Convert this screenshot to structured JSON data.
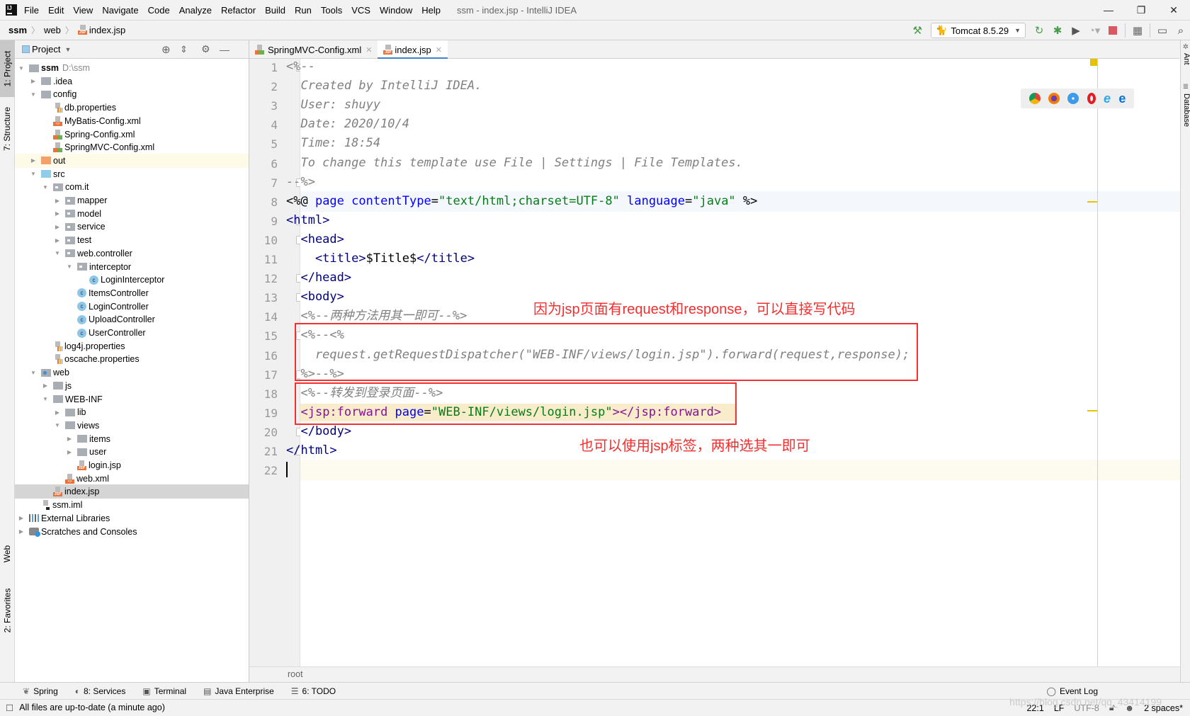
{
  "window": {
    "title": "ssm - index.jsp - IntelliJ IDEA",
    "menu": [
      "File",
      "Edit",
      "View",
      "Navigate",
      "Code",
      "Analyze",
      "Refactor",
      "Build",
      "Run",
      "Tools",
      "VCS",
      "Window",
      "Help"
    ],
    "controls": {
      "minimize": "—",
      "maximize": "❐",
      "close": "✕"
    }
  },
  "breadcrumb": [
    "ssm",
    "web",
    "index.jsp"
  ],
  "toolbar": {
    "run_config": "Tomcat 8.5.29",
    "icons": [
      "build-hammer-icon",
      "rerun-icon",
      "debug-icon",
      "coverage-icon",
      "profile-icon",
      "stop-icon",
      "project-structure-icon",
      "run-anything-icon",
      "search-everywhere-icon"
    ]
  },
  "left_stripe": {
    "project": "1: Project",
    "structure": "7: Structure",
    "web": "Web",
    "favorites": "2: Favorites"
  },
  "right_stripe": {
    "ant": "Ant",
    "database": "Database"
  },
  "project_panel": {
    "title": "Project",
    "tree": [
      {
        "label": "ssm",
        "hint": "D:\\ssm",
        "depth": 0,
        "arrow": "down",
        "icon": "folder",
        "bold": true
      },
      {
        "label": ".idea",
        "depth": 1,
        "arrow": "right",
        "icon": "folder"
      },
      {
        "label": "config",
        "depth": 1,
        "arrow": "down",
        "icon": "folder"
      },
      {
        "label": "db.properties",
        "depth": 2,
        "icon": "props"
      },
      {
        "label": "MyBatis-Config.xml",
        "depth": 2,
        "icon": "xml"
      },
      {
        "label": "Spring-Config.xml",
        "depth": 2,
        "icon": "spring"
      },
      {
        "label": "SpringMVC-Config.xml",
        "depth": 2,
        "icon": "spring"
      },
      {
        "label": "out",
        "depth": 1,
        "arrow": "right",
        "icon": "folder-orange",
        "highlight": true
      },
      {
        "label": "src",
        "depth": 1,
        "arrow": "down",
        "icon": "folder-blue"
      },
      {
        "label": "com.it",
        "depth": 2,
        "arrow": "down",
        "icon": "pkg"
      },
      {
        "label": "mapper",
        "depth": 3,
        "arrow": "right",
        "icon": "pkg"
      },
      {
        "label": "model",
        "depth": 3,
        "arrow": "right",
        "icon": "pkg"
      },
      {
        "label": "service",
        "depth": 3,
        "arrow": "right",
        "icon": "pkg"
      },
      {
        "label": "test",
        "depth": 3,
        "arrow": "right",
        "icon": "pkg"
      },
      {
        "label": "web.controller",
        "depth": 3,
        "arrow": "down",
        "icon": "pkg"
      },
      {
        "label": "interceptor",
        "depth": 4,
        "arrow": "down",
        "icon": "pkg"
      },
      {
        "label": "LoginInterceptor",
        "depth": 5,
        "icon": "class"
      },
      {
        "label": "ItemsController",
        "depth": 4,
        "icon": "class"
      },
      {
        "label": "LoginController",
        "depth": 4,
        "icon": "class"
      },
      {
        "label": "UploadController",
        "depth": 4,
        "icon": "class"
      },
      {
        "label": "UserController",
        "depth": 4,
        "icon": "class"
      },
      {
        "label": "log4j.properties",
        "depth": 2,
        "icon": "props"
      },
      {
        "label": "oscache.properties",
        "depth": 2,
        "icon": "props"
      },
      {
        "label": "web",
        "depth": 1,
        "arrow": "down",
        "icon": "web"
      },
      {
        "label": "js",
        "depth": 2,
        "arrow": "right",
        "icon": "folder"
      },
      {
        "label": "WEB-INF",
        "depth": 2,
        "arrow": "down",
        "icon": "folder"
      },
      {
        "label": "lib",
        "depth": 3,
        "arrow": "right",
        "icon": "folder"
      },
      {
        "label": "views",
        "depth": 3,
        "arrow": "down",
        "icon": "folder"
      },
      {
        "label": "items",
        "depth": 4,
        "arrow": "right",
        "icon": "folder"
      },
      {
        "label": "user",
        "depth": 4,
        "arrow": "right",
        "icon": "folder"
      },
      {
        "label": "login.jsp",
        "depth": 4,
        "icon": "jsp"
      },
      {
        "label": "web.xml",
        "depth": 3,
        "icon": "xml"
      },
      {
        "label": "index.jsp",
        "depth": 2,
        "icon": "jsp",
        "selected": true
      },
      {
        "label": "ssm.iml",
        "depth": 1,
        "icon": "iml"
      },
      {
        "label": "External Libraries",
        "depth": 0,
        "arrow": "right",
        "icon": "lib"
      },
      {
        "label": "Scratches and Consoles",
        "depth": 0,
        "arrow": "right",
        "icon": "scratch"
      }
    ]
  },
  "editor": {
    "tabs": [
      {
        "label": "SpringMVC-Config.xml",
        "active": false
      },
      {
        "label": "index.jsp",
        "active": true
      }
    ],
    "lines": [
      {
        "n": "1",
        "segs": [
          [
            "cm",
            "<%--"
          ]
        ]
      },
      {
        "n": "2",
        "segs": [
          [
            "cm",
            "  Created by IntelliJ IDEA."
          ]
        ]
      },
      {
        "n": "3",
        "segs": [
          [
            "cm",
            "  User: shuyy"
          ]
        ]
      },
      {
        "n": "4",
        "segs": [
          [
            "cm",
            "  Date: 2020/10/4"
          ]
        ]
      },
      {
        "n": "5",
        "segs": [
          [
            "cm",
            "  Time: 18:54"
          ]
        ]
      },
      {
        "n": "6",
        "segs": [
          [
            "cm",
            "  To change this template use File | Settings | File Templates."
          ]
        ]
      },
      {
        "n": "7",
        "segs": [
          [
            "cm",
            "--%>"
          ]
        ]
      },
      {
        "n": "8",
        "segs": [
          [
            "def",
            "<%@ "
          ],
          [
            "attr",
            "page "
          ],
          [
            "attr",
            "contentType"
          ],
          [
            "def",
            "="
          ],
          [
            "str",
            "\"text/html;charset=UTF-8\""
          ],
          [
            "def",
            " "
          ],
          [
            "attr",
            "language"
          ],
          [
            "def",
            "="
          ],
          [
            "str",
            "\"java\""
          ],
          [
            "def",
            " %>"
          ]
        ]
      },
      {
        "n": "9",
        "segs": [
          [
            "tag",
            "<html>"
          ]
        ]
      },
      {
        "n": "10",
        "segs": [
          [
            "tag",
            "  <head>"
          ]
        ]
      },
      {
        "n": "11",
        "segs": [
          [
            "tag",
            "    <title>"
          ],
          [
            "def",
            "$Title$"
          ],
          [
            "tag",
            "</title>"
          ]
        ]
      },
      {
        "n": "12",
        "segs": [
          [
            "tag",
            "  </head>"
          ]
        ]
      },
      {
        "n": "13",
        "segs": [
          [
            "tag",
            "  <body>"
          ]
        ]
      },
      {
        "n": "14",
        "segs": [
          [
            "cm",
            "  <%--两种方法用其一即可--%>"
          ]
        ]
      },
      {
        "n": "15",
        "segs": [
          [
            "cm",
            "  <%--<%"
          ]
        ]
      },
      {
        "n": "16",
        "segs": [
          [
            "cm",
            "    request.getRequestDispatcher(\"WEB-INF/views/login.jsp\").forward(request,response);"
          ]
        ]
      },
      {
        "n": "17",
        "segs": [
          [
            "cm",
            "  %>--%>"
          ]
        ]
      },
      {
        "n": "18",
        "segs": [
          [
            "cm",
            "  <%--转发到登录页面--%>"
          ]
        ]
      },
      {
        "n": "19",
        "segs": [
          [
            "def",
            "  "
          ],
          [
            "jsp",
            "<jsp:forward "
          ],
          [
            "attr",
            "page"
          ],
          [
            "def",
            "="
          ],
          [
            "str",
            "\"WEB-INF/views/login.jsp\""
          ],
          [
            "jsp",
            "></jsp:forward>"
          ]
        ]
      },
      {
        "n": "20",
        "segs": [
          [
            "tag",
            "  </body>"
          ]
        ]
      },
      {
        "n": "21",
        "segs": [
          [
            "tag",
            "</html>"
          ]
        ]
      },
      {
        "n": "22",
        "segs": [
          [
            "def",
            ""
          ]
        ]
      }
    ],
    "annotations": {
      "top": "因为jsp页面有request和response，可以直接写代码",
      "bottom": "也可以使用jsp标签，两种选其一即可"
    },
    "breadcrumb_footer": "root",
    "browser_icons": [
      "chrome-icon",
      "firefox-icon",
      "safari-icon",
      "opera-icon",
      "ie-icon",
      "edge-icon"
    ],
    "colors": {
      "comment": "#808080",
      "tag": "#000080",
      "attr": "#0000ff",
      "string": "#067d17",
      "jsp": "#871094",
      "annotation": "#f13030"
    }
  },
  "tool_windows": [
    {
      "label": "Spring",
      "icon": "spring-leaf-icon"
    },
    {
      "label": "8: Services",
      "icon": "services-icon"
    },
    {
      "label": "Terminal",
      "icon": "terminal-icon"
    },
    {
      "label": "Java Enterprise",
      "icon": "java-enterprise-icon"
    },
    {
      "label": "6: TODO",
      "icon": "todo-icon"
    }
  ],
  "event_log": "Event Log",
  "status": {
    "message": "All files are up-to-date (a minute ago)",
    "position": "22:1",
    "line_sep": "LF",
    "encoding": "UTF-8",
    "indent": "2 spaces*",
    "watermark": "https://blog.csdn.net/qq_43414199"
  }
}
